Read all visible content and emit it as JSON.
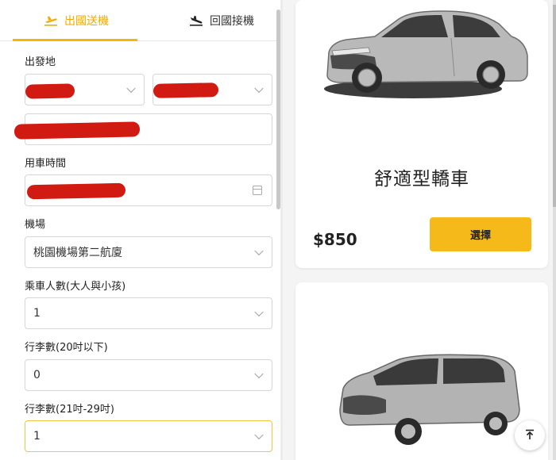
{
  "tabs": {
    "departure_label": "出國送機",
    "return_label": "回國接機"
  },
  "form": {
    "origin_label": "出發地",
    "time_label": "用車時間",
    "airport_label": "機場",
    "airport_value": "桃園機場第二航廈",
    "passengers_label": "乘車人數(大人與小孩)",
    "passengers_value": "1",
    "luggage_small_label": "行李數(20吋以下)",
    "luggage_small_value": "0",
    "luggage_large_label": "行李數(21吋-29吋)",
    "luggage_large_value": "1"
  },
  "cars": [
    {
      "name": "舒適型轎車",
      "price": "$850",
      "select_label": "選擇"
    }
  ],
  "colors": {
    "accent": "#f5b800",
    "button": "#f6b91a",
    "redaction": "#d11a12"
  },
  "icons": {
    "departure": "plane-takeoff-icon",
    "return": "plane-landing-icon",
    "calendar": "calendar-icon",
    "back_to_top": "arrow-up-icon"
  }
}
